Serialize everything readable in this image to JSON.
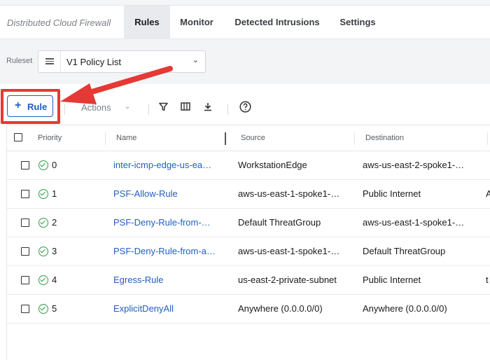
{
  "app": {
    "title": "Distributed Cloud Firewall"
  },
  "tabs": [
    {
      "label": "Rules",
      "active": true
    },
    {
      "label": "Monitor",
      "active": false
    },
    {
      "label": "Detected Intrusions",
      "active": false
    },
    {
      "label": "Settings",
      "active": false
    }
  ],
  "filter": {
    "ruleset_label": "Ruleset",
    "ruleset_value": "V1 Policy List"
  },
  "toolbar": {
    "add_label": "Rule",
    "actions_label": "Actions",
    "icons": [
      "filter-icon",
      "columns-icon",
      "download-icon",
      "help-icon"
    ]
  },
  "table": {
    "headers": {
      "priority": "Priority",
      "name": "Name",
      "source": "Source",
      "destination": "Destination"
    },
    "rows": [
      {
        "priority": "0",
        "name": "inter-icmp-edge-us-ea…",
        "source": "WorkstationEdge",
        "destination": "aws-us-east-2-spoke1-…",
        "extra": ""
      },
      {
        "priority": "1",
        "name": "PSF-Allow-Rule",
        "source": "aws-us-east-1-spoke1-…",
        "destination": "Public Internet",
        "extra": "A"
      },
      {
        "priority": "2",
        "name": "PSF-Deny-Rule-from-…",
        "source": "Default ThreatGroup",
        "destination": "aws-us-east-1-spoke1-…",
        "extra": ""
      },
      {
        "priority": "3",
        "name": "PSF-Deny-Rule-from-a…",
        "source": "aws-us-east-1-spoke1-…",
        "destination": "Default ThreatGroup",
        "extra": ""
      },
      {
        "priority": "4",
        "name": "Egress-Rule",
        "source": "us-east-2-private-subnet",
        "destination": "Public Internet",
        "extra": "t"
      },
      {
        "priority": "5",
        "name": "ExplicitDenyAll",
        "source": "Anywhere (0.0.0.0/0)",
        "destination": "Anywhere (0.0.0.0/0)",
        "extra": ""
      }
    ]
  },
  "annotation": {
    "highlight_color": "#e53935"
  },
  "colors": {
    "accent": "#1f5fbf",
    "status_ok": "#2e9e45"
  }
}
